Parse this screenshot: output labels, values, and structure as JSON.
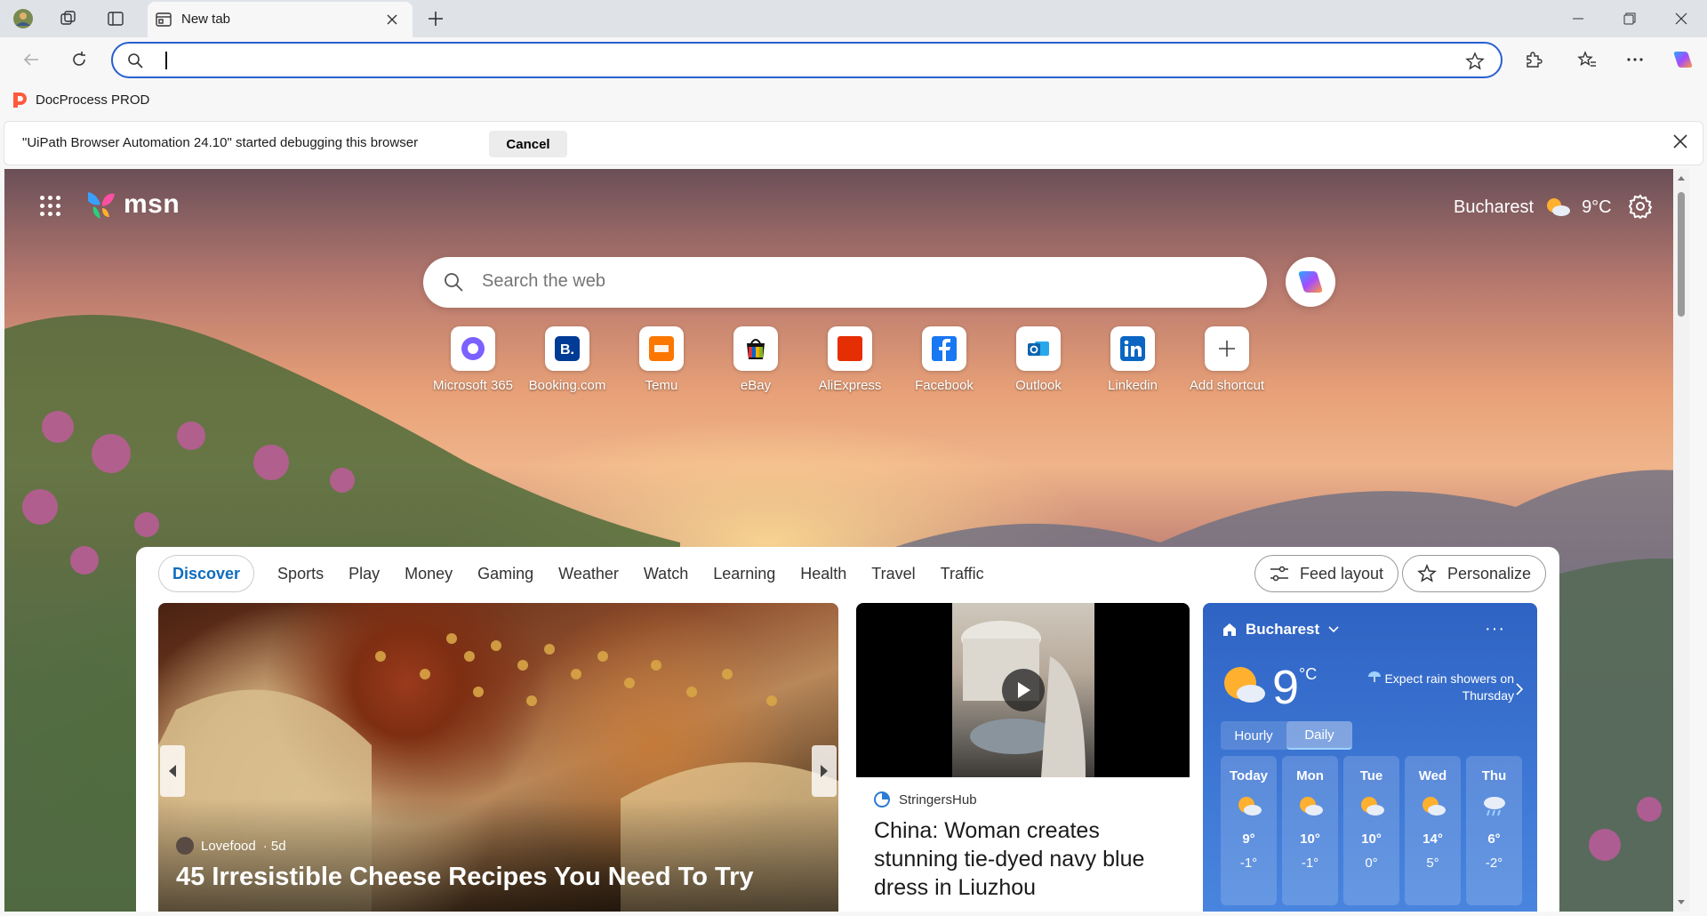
{
  "browser": {
    "tab_title": "New tab",
    "address_value": "",
    "favorites": [
      {
        "label": "DocProcess PROD"
      }
    ],
    "infobar": {
      "message": "\"UiPath Browser Automation 24.10\" started debugging this browser",
      "cancel_label": "Cancel"
    }
  },
  "msn": {
    "logo_text": "msn",
    "location": "Bucharest",
    "temp_header": "9°C",
    "search_placeholder": "Search the web",
    "shortcuts": [
      {
        "label": "Microsoft 365",
        "icon": "microsoft-365-icon",
        "color": "#7b61ff"
      },
      {
        "label": "Booking.com",
        "icon": "booking-icon",
        "color": "#003b95"
      },
      {
        "label": "Temu",
        "icon": "temu-icon",
        "color": "#fb7701"
      },
      {
        "label": "eBay",
        "icon": "ebay-icon",
        "color": "#e53238"
      },
      {
        "label": "AliExpress",
        "icon": "aliexpress-icon",
        "color": "#e62e04"
      },
      {
        "label": "Facebook",
        "icon": "facebook-icon",
        "color": "#1877f2"
      },
      {
        "label": "Outlook",
        "icon": "outlook-icon",
        "color": "#0a64ad"
      },
      {
        "label": "Linkedin",
        "icon": "linkedin-icon",
        "color": "#0a66c2"
      },
      {
        "label": "Add shortcut",
        "icon": "plus-icon",
        "color": "#444444"
      }
    ],
    "feed": {
      "tabs": [
        "Discover",
        "Sports",
        "Play",
        "Money",
        "Gaming",
        "Weather",
        "Watch",
        "Learning",
        "Health",
        "Travel",
        "Traffic"
      ],
      "feed_layout_label": "Feed layout",
      "personalize_label": "Personalize",
      "hero": {
        "source": "Lovefood",
        "age": "· 5d",
        "title": "45 Irresistible Cheese Recipes You Need To Try"
      },
      "video": {
        "source": "StringersHub",
        "title": "China: Woman creates stunning tie-dyed navy blue dress in Liuzhou"
      },
      "weather": {
        "location": "Bucharest",
        "temp": "9",
        "unit": "°C",
        "alert": "Expect rain showers on Thursday",
        "toggle": [
          "Hourly",
          "Daily"
        ],
        "days": [
          {
            "name": "Today",
            "icon": "partly-sunny-icon",
            "hi": "9°",
            "lo": "-1°"
          },
          {
            "name": "Mon",
            "icon": "partly-sunny-icon",
            "hi": "10°",
            "lo": "-1°"
          },
          {
            "name": "Tue",
            "icon": "partly-sunny-icon",
            "hi": "10°",
            "lo": "0°"
          },
          {
            "name": "Wed",
            "icon": "partly-sunny-icon",
            "hi": "14°",
            "lo": "5°"
          },
          {
            "name": "Thu",
            "icon": "rain-icon",
            "hi": "6°",
            "lo": "-2°"
          }
        ]
      }
    }
  }
}
